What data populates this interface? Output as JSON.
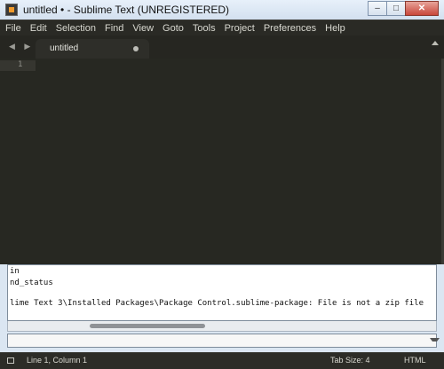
{
  "window": {
    "title": "untitled • - Sublime Text (UNREGISTERED)",
    "buttons": {
      "minimize": "–",
      "maximize": "□",
      "close": "✕"
    }
  },
  "menu": {
    "items": [
      "File",
      "Edit",
      "Selection",
      "Find",
      "View",
      "Goto",
      "Tools",
      "Project",
      "Preferences",
      "Help"
    ]
  },
  "tabs": {
    "nav": "◀ ▶",
    "active": {
      "label": "untitled",
      "modified": true
    }
  },
  "editor": {
    "line_numbers": [
      "1"
    ]
  },
  "console": {
    "lines": [
      "in",
      "nd_status",
      "lime Text 3\\Installed Packages\\Package Control.sublime-package: File is not a zip file"
    ],
    "input_value": ""
  },
  "status": {
    "position": "Line 1, Column 1",
    "tab_size": "Tab Size: 4",
    "syntax": "HTML"
  },
  "colors": {
    "editor_bg": "#272822",
    "chrome_bg": "#2a2a25",
    "accent": "#f19a2b"
  }
}
